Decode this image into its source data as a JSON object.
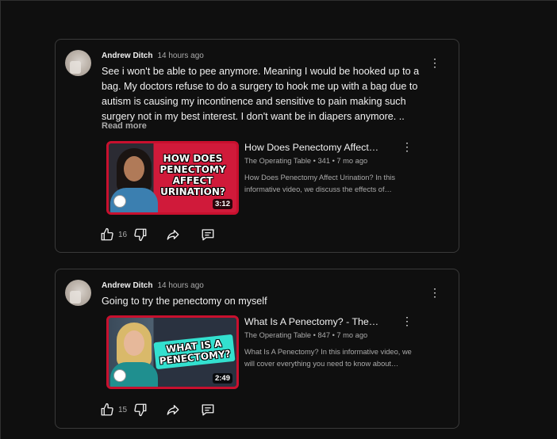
{
  "comments": [
    {
      "author": "Andrew Ditch",
      "time": "14 hours ago",
      "text": "See i won't be able to pee anymore. Meaning I would be hooked up to a bag. My doctors refuse to do a surgery to hook me up with a bag due to autism is causing my incontinence and sensitive to pain making such surgery not in my best interest. I don't want be in diapers anymore. ..",
      "read_more": "Read more",
      "video": {
        "title": "How Does Penectomy Affect…",
        "channel_meta": "The Operating Table • 341 • 7 mo ago",
        "description": "How Does Penectomy Affect Urination? In this informative video, we discuss the effects of…",
        "thumb_text": "HOW DOES PENECTOMY AFFECT URINATION?",
        "duration": "3:12"
      },
      "likes": "16"
    },
    {
      "author": "Andrew Ditch",
      "time": "14 hours ago",
      "text": "Going to try the penectomy on myself",
      "video": {
        "title": "What Is A Penectomy? - The…",
        "channel_meta": "The Operating Table • 847 • 7 mo ago",
        "description": "What Is A Penectomy? In this informative video, we will cover everything you need to know about…",
        "thumb_text": "WHAT IS A PENECTOMY?",
        "duration": "2:49"
      },
      "likes": "15"
    }
  ],
  "icons": {
    "menu": "⋮",
    "like": "thumbs-up-icon",
    "dislike": "thumbs-down-icon",
    "share": "share-icon",
    "reply": "reply-comment-icon"
  },
  "colors": {
    "background": "#0f0f0f",
    "card_border": "#3a3a3a",
    "thumb_border": "#c8102e",
    "secondary_text": "#aaaaaa"
  }
}
